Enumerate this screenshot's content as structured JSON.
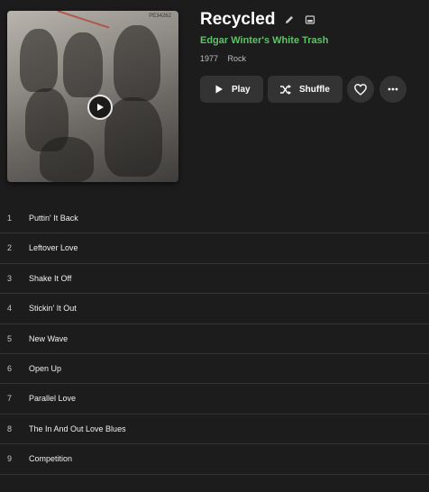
{
  "album": {
    "title": "Recycled",
    "artist": "Edgar Winter's White Trash",
    "year": "1977",
    "genre": "Rock",
    "cover_catalog_number": "PE34262"
  },
  "actions": {
    "play_label": "Play",
    "shuffle_label": "Shuffle"
  },
  "icons": [
    "play-icon",
    "pencil-icon",
    "image-icon",
    "shuffle-icon",
    "heart-icon",
    "ellipsis-icon"
  ],
  "colors": {
    "background": "#1c1c1c",
    "artist_accent": "#5ec267",
    "button_bg": "#333333",
    "divider": "#343434"
  },
  "tracks": [
    {
      "number": "1",
      "name": "Puttin' It Back"
    },
    {
      "number": "2",
      "name": "Leftover Love"
    },
    {
      "number": "3",
      "name": "Shake It Off"
    },
    {
      "number": "4",
      "name": "Stickin' It Out"
    },
    {
      "number": "5",
      "name": "New Wave"
    },
    {
      "number": "6",
      "name": "Open Up"
    },
    {
      "number": "7",
      "name": "Parallel Love"
    },
    {
      "number": "8",
      "name": "The In And Out Love Blues"
    },
    {
      "number": "9",
      "name": "Competition"
    }
  ]
}
